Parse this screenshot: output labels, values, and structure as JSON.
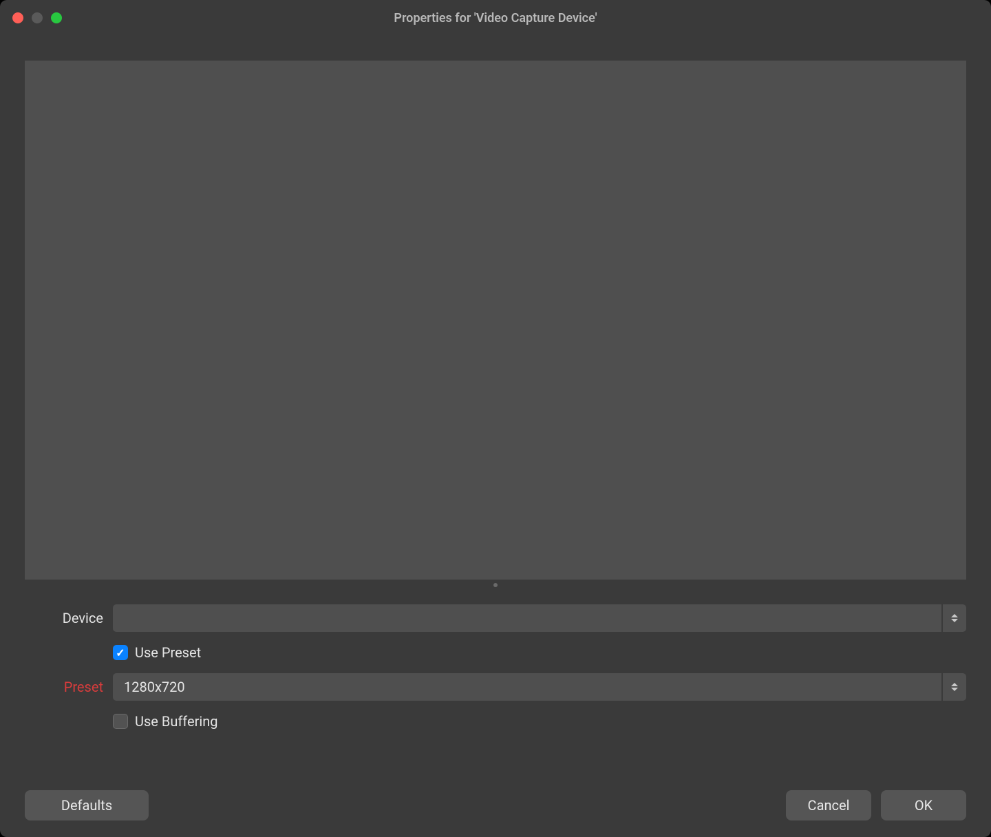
{
  "window": {
    "title": "Properties for 'Video Capture Device'"
  },
  "form": {
    "device": {
      "label": "Device",
      "value": ""
    },
    "use_preset": {
      "label": "Use Preset",
      "checked": true
    },
    "preset": {
      "label": "Preset",
      "value": "1280x720",
      "warning": true
    },
    "use_buffering": {
      "label": "Use Buffering",
      "checked": false
    }
  },
  "buttons": {
    "defaults": "Defaults",
    "cancel": "Cancel",
    "ok": "OK"
  }
}
